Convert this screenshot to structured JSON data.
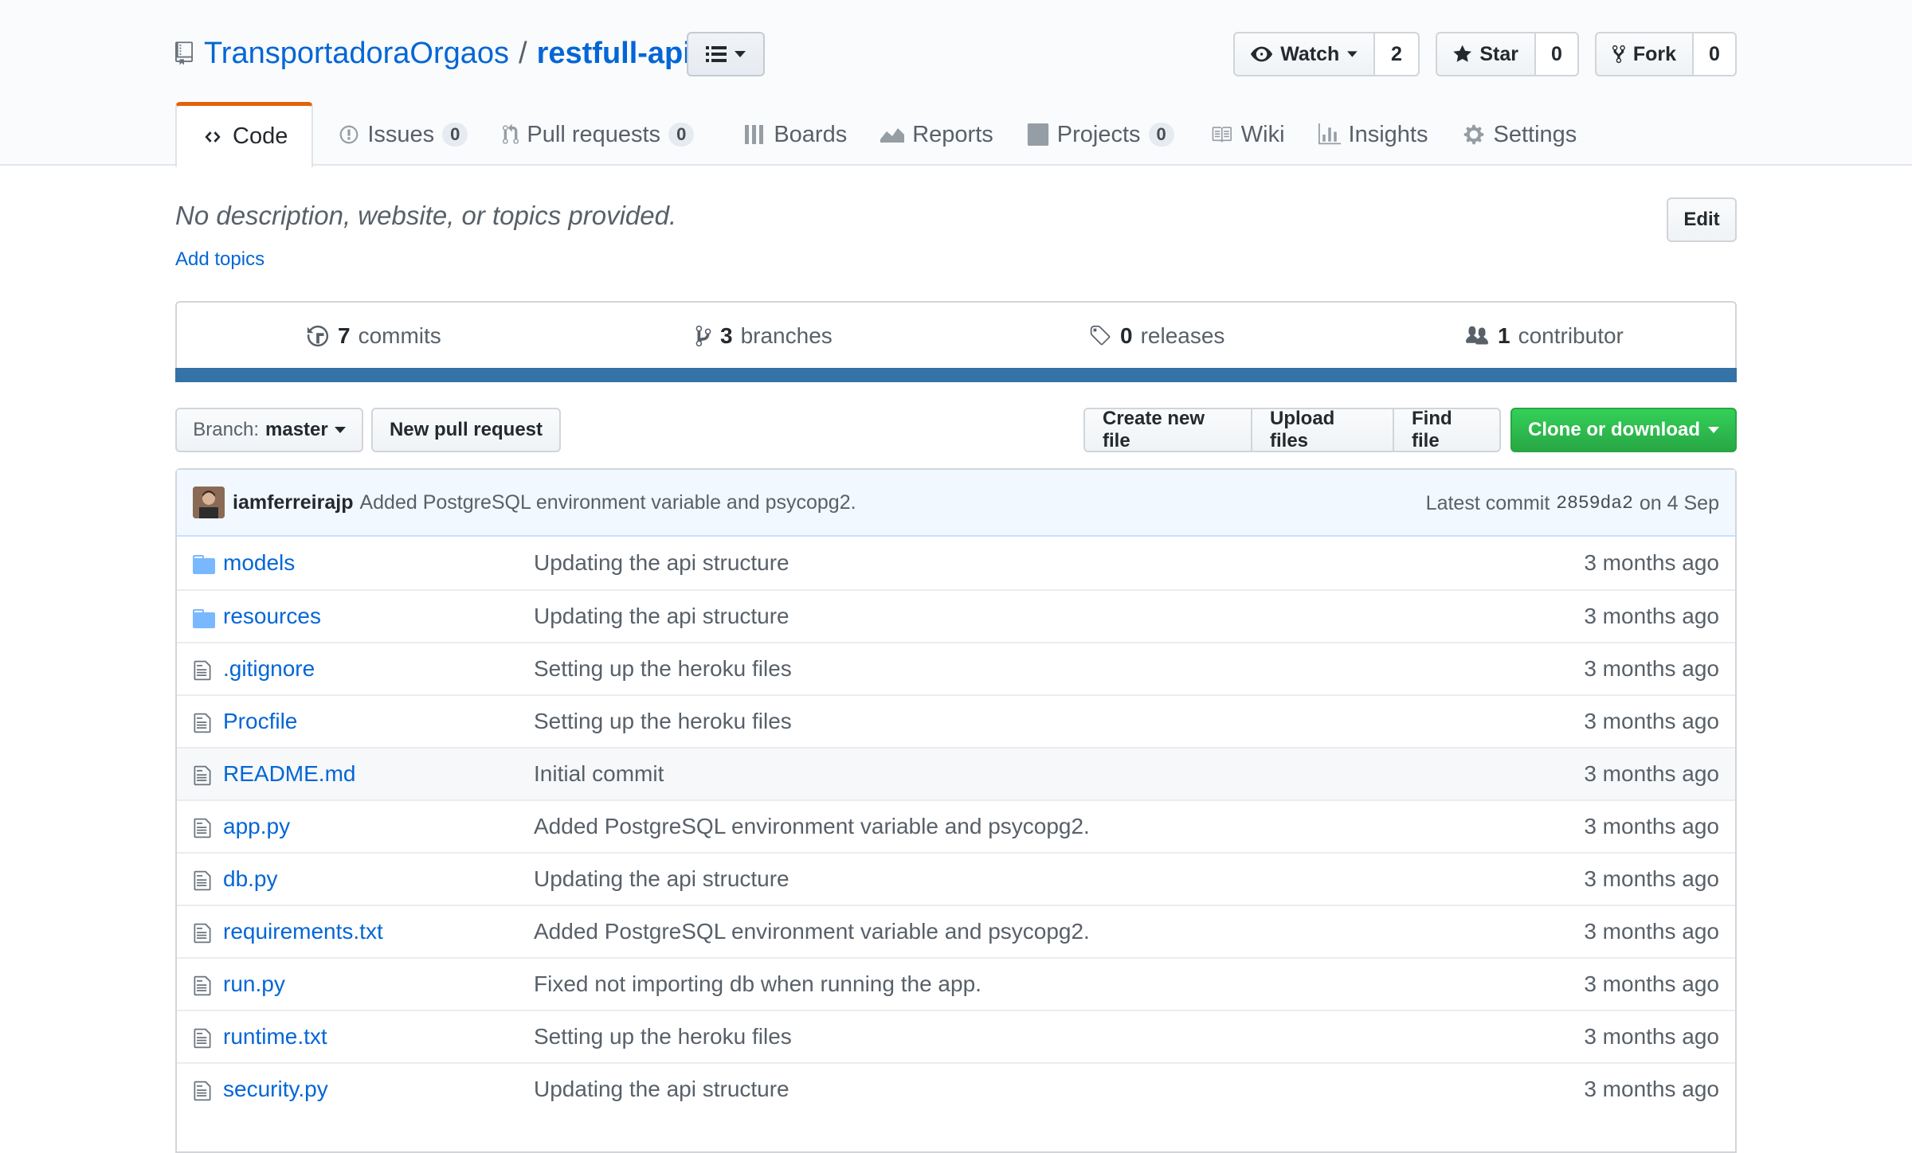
{
  "repo": {
    "owner": "TransportadoraOrgaos",
    "separator": "/",
    "name": "restfull-api"
  },
  "social": {
    "watch_label": "Watch",
    "watch_count": "2",
    "star_label": "Star",
    "star_count": "0",
    "fork_label": "Fork",
    "fork_count": "0"
  },
  "tabs": [
    {
      "label": "Code",
      "icon": "code-icon"
    },
    {
      "label": "Issues",
      "count": "0",
      "icon": "issue-icon"
    },
    {
      "label": "Pull requests",
      "count": "0",
      "icon": "pull-request-icon"
    },
    {
      "label": "Boards",
      "icon": "boards-icon"
    },
    {
      "label": "Reports",
      "icon": "graph-icon"
    },
    {
      "label": "Projects",
      "count": "0",
      "icon": "project-icon"
    },
    {
      "label": "Wiki",
      "icon": "book-icon"
    },
    {
      "label": "Insights",
      "icon": "bar-chart-icon"
    },
    {
      "label": "Settings",
      "icon": "gear-icon"
    }
  ],
  "description": {
    "text": "No description, website, or topics provided.",
    "add_topics": "Add topics",
    "edit_label": "Edit"
  },
  "summary": {
    "commits_count": "7",
    "commits_label": "commits",
    "branches_count": "3",
    "branches_label": "branches",
    "releases_count": "0",
    "releases_label": "releases",
    "contributors_count": "1",
    "contributors_label": "contributor",
    "language_color": "#3572a5"
  },
  "toolbar": {
    "branch_prefix": "Branch:",
    "branch_name": "master",
    "new_pull_request": "New pull request",
    "create_new_file": "Create new file",
    "upload_files": "Upload files",
    "find_file": "Find file",
    "clone_or_download": "Clone or download"
  },
  "latest_commit": {
    "author": "iamferreirajp",
    "message": "Added PostgreSQL environment variable and psycopg2.",
    "prefix": "Latest commit",
    "sha": "2859da2",
    "date": "on 4 Sep"
  },
  "files": [
    {
      "name": "models",
      "type": "dir",
      "message": "Updating the api structure",
      "age": "3 months ago"
    },
    {
      "name": "resources",
      "type": "dir",
      "message": "Updating the api structure",
      "age": "3 months ago"
    },
    {
      "name": ".gitignore",
      "type": "file",
      "message": "Setting up the heroku files",
      "age": "3 months ago"
    },
    {
      "name": "Procfile",
      "type": "file",
      "message": "Setting up the heroku files",
      "age": "3 months ago"
    },
    {
      "name": "README.md",
      "type": "file",
      "message": "Initial commit",
      "age": "3 months ago"
    },
    {
      "name": "app.py",
      "type": "file",
      "message": "Added PostgreSQL environment variable and psycopg2.",
      "age": "3 months ago"
    },
    {
      "name": "db.py",
      "type": "file",
      "message": "Updating the api structure",
      "age": "3 months ago"
    },
    {
      "name": "requirements.txt",
      "type": "file",
      "message": "Added PostgreSQL environment variable and psycopg2.",
      "age": "3 months ago"
    },
    {
      "name": "run.py",
      "type": "file",
      "message": "Fixed not importing db when running the app.",
      "age": "3 months ago"
    },
    {
      "name": "runtime.txt",
      "type": "file",
      "message": "Setting up the heroku files",
      "age": "3 months ago"
    },
    {
      "name": "security.py",
      "type": "file",
      "message": "Updating the api structure",
      "age": "3 months ago"
    }
  ]
}
